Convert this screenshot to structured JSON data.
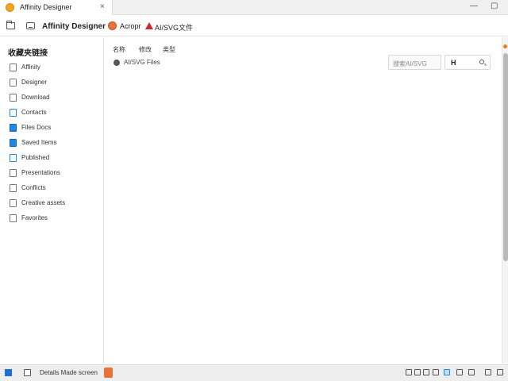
{
  "window": {
    "tab_title": "Affinity Designer",
    "tab_close": "×",
    "minimize": "—",
    "maximize": "▢"
  },
  "toolbar": {
    "app_name": "Affinity Designer",
    "breadcrumb_part1": "Acropr",
    "breadcrumb_part2": "AI/SVG文件"
  },
  "sidebar": {
    "title": "收藏夹链接",
    "items": [
      {
        "label": "Affinity",
        "icon": "document-icon",
        "color": "outline"
      },
      {
        "label": "Designer",
        "icon": "document-icon",
        "color": "outline"
      },
      {
        "label": "Download",
        "icon": "document-icon",
        "color": "outline"
      },
      {
        "label": "Contacts",
        "icon": "contact-icon",
        "color": "blue-outline"
      },
      {
        "label": "Files Docs",
        "icon": "folder-icon",
        "color": "blue"
      },
      {
        "label": "Saved Items",
        "icon": "folder-icon",
        "color": "blue"
      },
      {
        "label": "Published",
        "icon": "document-icon",
        "color": "blue-outline"
      },
      {
        "label": "Presentations",
        "icon": "document-icon",
        "color": "outline"
      },
      {
        "label": "Conflicts",
        "icon": "image-icon",
        "color": "outline"
      },
      {
        "label": "Creative assets",
        "icon": "document-icon",
        "color": "outline"
      },
      {
        "label": "Favorites",
        "icon": "document-icon",
        "color": "outline"
      }
    ]
  },
  "main": {
    "columns": [
      "名称",
      "修改",
      "类型"
    ],
    "entry_label": "AI/SVG Files",
    "filter_placeholder": "搜索AI/SVG",
    "search_cursor": "H",
    "accent": "#f07a1a"
  },
  "taskbar": {
    "label": "Details Made screen"
  }
}
